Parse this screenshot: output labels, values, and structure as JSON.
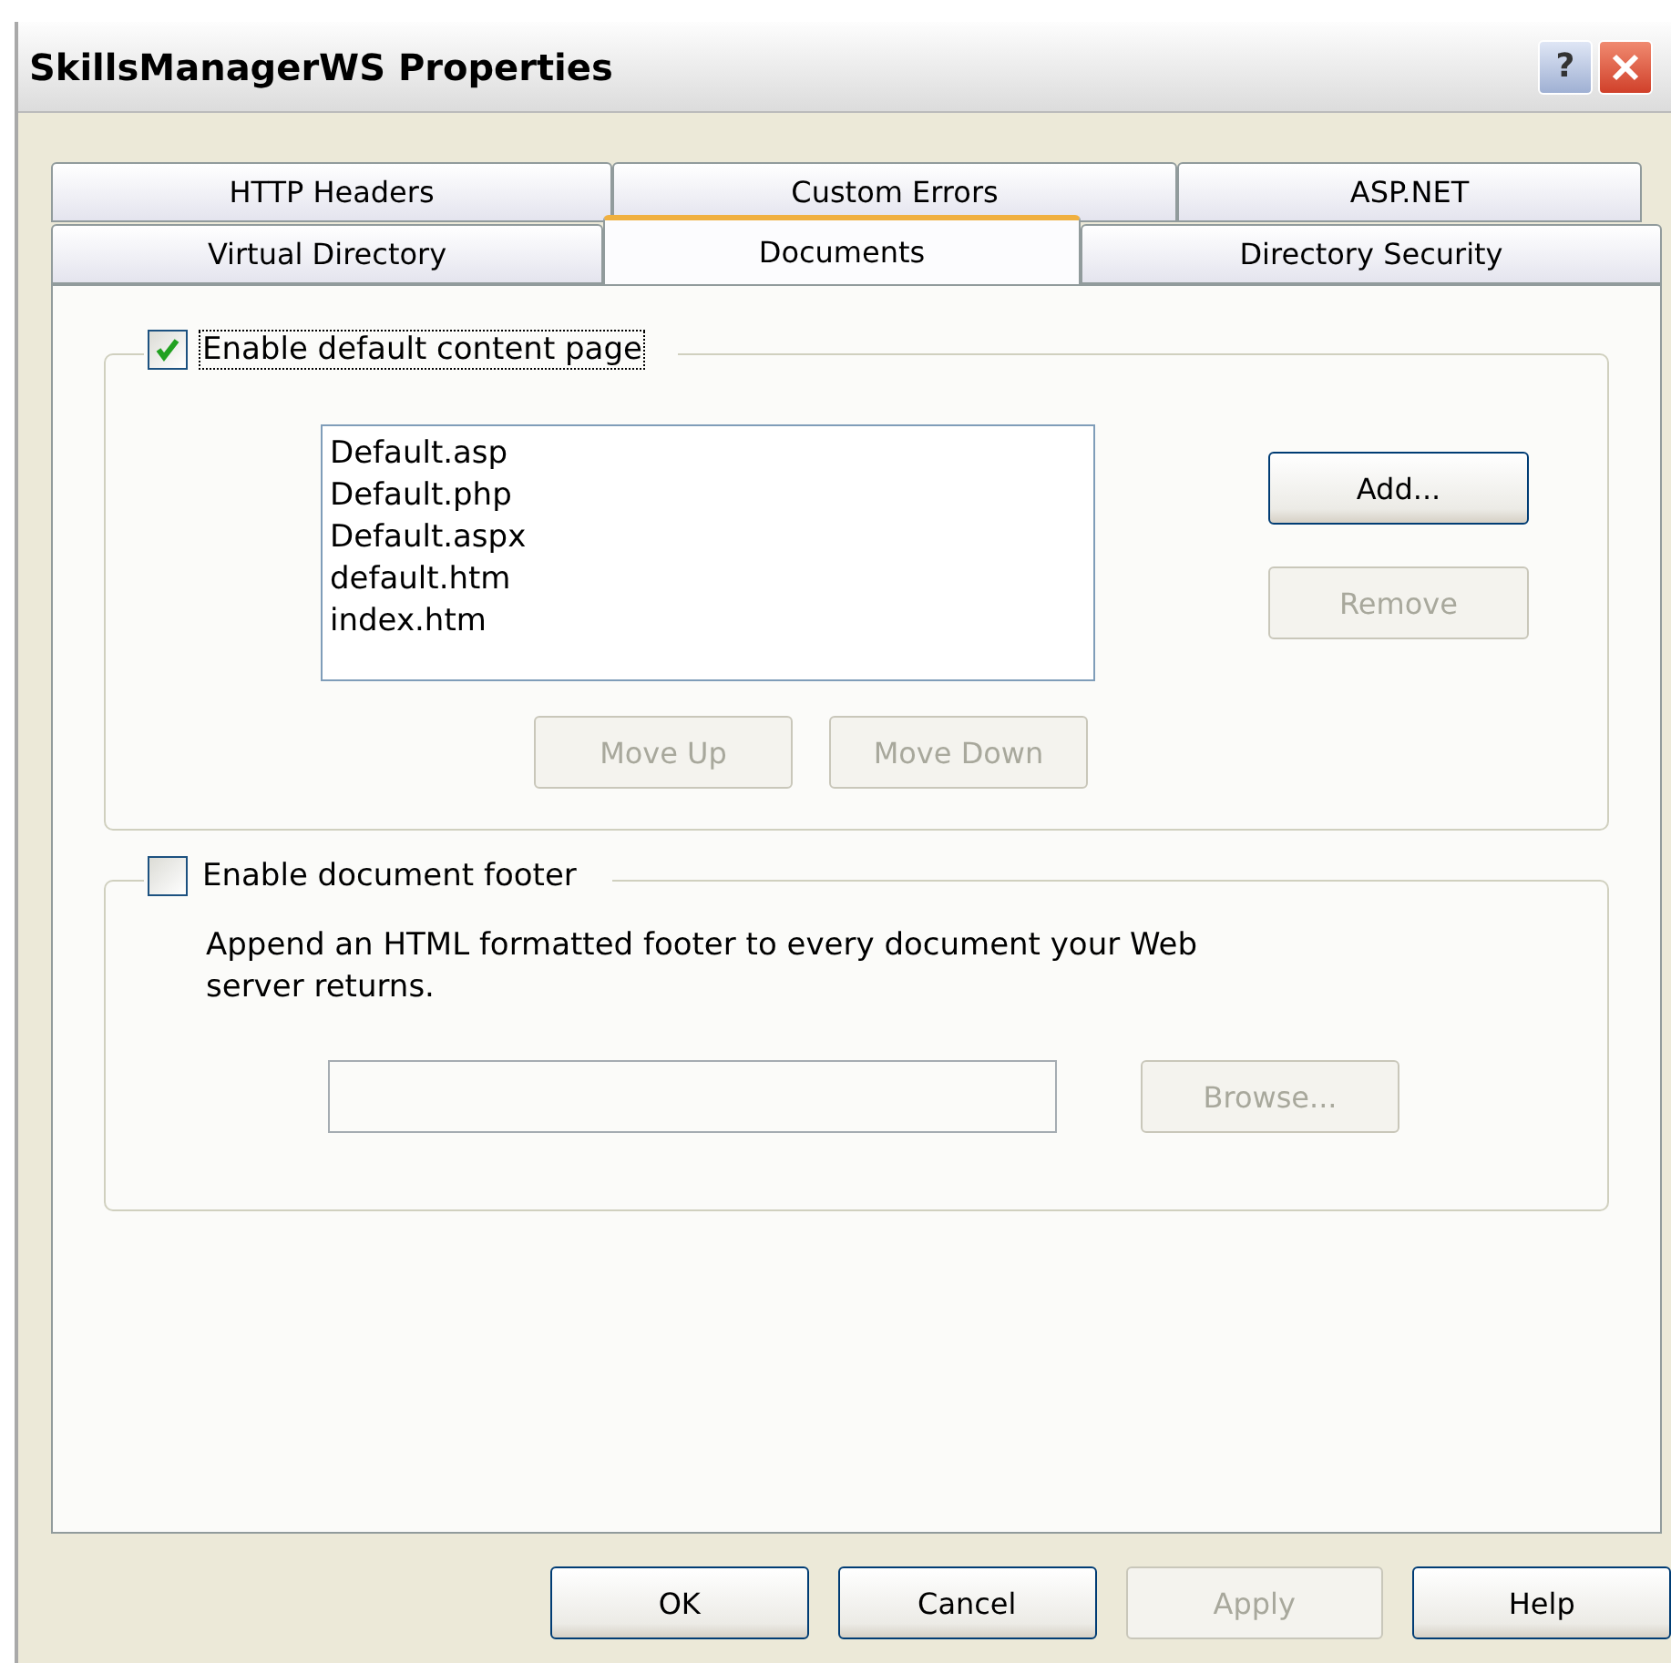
{
  "window": {
    "title": "SkillsManagerWS Properties",
    "help_label": "?"
  },
  "tab_rows": [
    [
      {
        "label": "HTTP Headers",
        "selected": false
      },
      {
        "label": "Custom Errors",
        "selected": false
      },
      {
        "label": "ASP.NET",
        "selected": false
      }
    ],
    [
      {
        "label": "Virtual Directory",
        "selected": false
      },
      {
        "label": "Documents",
        "selected": true
      },
      {
        "label": "Directory Security",
        "selected": false
      }
    ]
  ],
  "default_content": {
    "label": "Enable default content page",
    "checked": true,
    "documents": [
      "Default.asp",
      "Default.php",
      "Default.aspx",
      "default.htm",
      "index.htm"
    ],
    "side_buttons": [
      {
        "label": "Add...",
        "disabled": false
      },
      {
        "label": "Remove",
        "disabled": true
      }
    ],
    "move_buttons": [
      {
        "label": "Move Up",
        "disabled": true
      },
      {
        "label": "Move Down",
        "disabled": true
      }
    ]
  },
  "footer": {
    "label": "Enable document footer",
    "checked": false,
    "description": "Append an HTML formatted footer to every document your Web server returns.",
    "browse": {
      "label": "Browse...",
      "disabled": true
    }
  },
  "dialog_buttons": [
    {
      "label": "OK",
      "disabled": false
    },
    {
      "label": "Cancel",
      "disabled": false
    },
    {
      "label": "Apply",
      "disabled": true
    },
    {
      "label": "Help",
      "disabled": false
    }
  ]
}
